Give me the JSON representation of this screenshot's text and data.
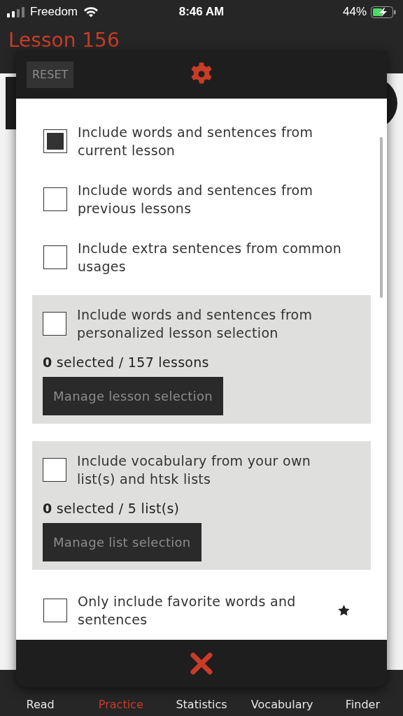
{
  "status_bar": {
    "carrier": "Freedom",
    "time": "8:46 AM",
    "battery": "44%"
  },
  "header": {
    "title": "Lesson 156"
  },
  "dialog": {
    "reset_button": "RESET",
    "options": [
      {
        "kind": "option",
        "label": "Include words and sentences from current lesson",
        "checked": true
      },
      {
        "kind": "option",
        "label": "Include words and sentences from previous lessons",
        "checked": false
      },
      {
        "kind": "option",
        "label": "Include extra sentences from common usages",
        "checked": false
      },
      {
        "kind": "panel",
        "label": "Include words and sentences from personalized lesson selection",
        "checked": false,
        "count": "**0** selected / 157 lessons",
        "button": "Manage lesson selection"
      },
      {
        "kind": "panel",
        "label": "Include vocabulary from your own list(s) and htsk lists",
        "checked": false,
        "count": "**0** selected / 5 list(s)",
        "button": "Manage list selection"
      },
      {
        "kind": "favorite",
        "label": "Only include favorite words and sentences",
        "checked": false
      }
    ]
  },
  "tab_bar": [
    {
      "label": "Read",
      "selected": false
    },
    {
      "label": "Practice",
      "selected": true
    },
    {
      "label": "Statistics",
      "selected": false
    },
    {
      "label": "Vocabulary",
      "selected": false
    },
    {
      "label": "Finder",
      "selected": false
    }
  ]
}
